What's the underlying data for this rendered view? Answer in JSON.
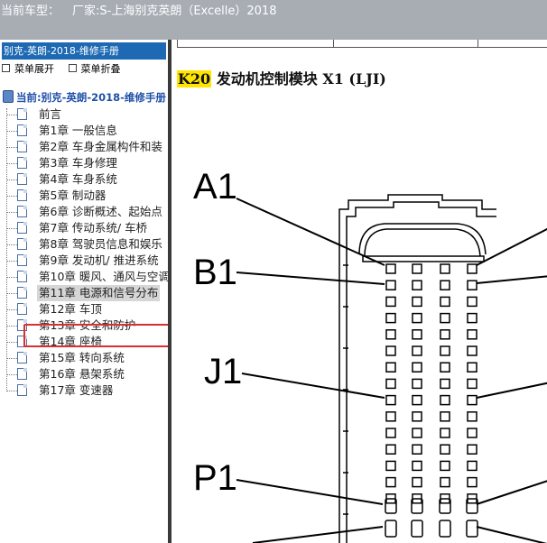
{
  "titlebar": {
    "vehicle_label": "当前车型：",
    "vehicle_value": "厂家:S-上海别克英朗（Excelle）2018"
  },
  "leftpane": {
    "header": "别克-英朗-2018-维修手册",
    "expand_label": "菜单展开",
    "collapse_label": "菜单折叠",
    "root_label": "当前:别克-英朗-2018-维修手册",
    "items": [
      {
        "label": "前言"
      },
      {
        "label": "第1章 一般信息"
      },
      {
        "label": "第2章 车身金属构件和装"
      },
      {
        "label": "第3章 车身修理"
      },
      {
        "label": "第4章 车身系统"
      },
      {
        "label": "第5章 制动器"
      },
      {
        "label": "第6章 诊断概述、起始点"
      },
      {
        "label": "第7章 传动系统/ 车桥"
      },
      {
        "label": "第8章 驾驶员信息和娱乐"
      },
      {
        "label": "第9章 发动机/ 推进系统"
      },
      {
        "label": "第10章 暖风、通风与空调"
      },
      {
        "label": "第11章 电源和信号分布"
      },
      {
        "label": "第12章 车顶"
      },
      {
        "label": "第13章 安全和防护"
      },
      {
        "label": "第14章 座椅"
      },
      {
        "label": "第15章 转向系统"
      },
      {
        "label": "第16章 悬架系统"
      },
      {
        "label": "第17章 变速器"
      }
    ],
    "selected_index": 11
  },
  "content": {
    "code": "K20",
    "title": " 发动机控制模块 X1 (LJI)",
    "pin_labels": [
      "A1",
      "B1",
      "J1",
      "P1"
    ]
  },
  "colors": {
    "titlebar_bg": "#a8adb4",
    "header_bg": "#1d69b3",
    "highlight_box": "#d93030",
    "code_highlight": "#ffe600"
  }
}
